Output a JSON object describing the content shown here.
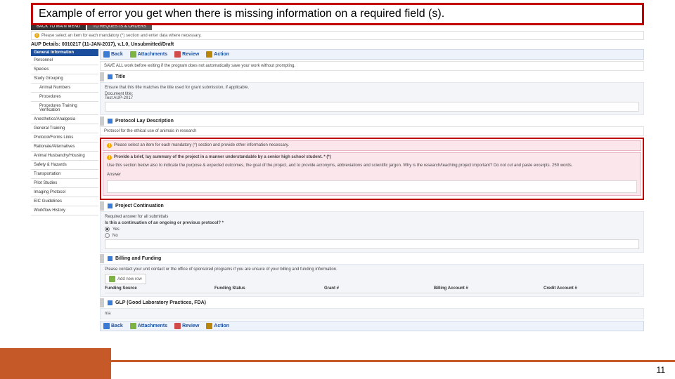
{
  "callout": "Example of error you get when there is missing information on a required field (s).",
  "tabs": {
    "back_main": "BACK TO MAIN MENU",
    "requests": "TO REQUESTS & ORDERS"
  },
  "top_warning": "Please select an item for each mandatory (*) section and enter data where necessary.",
  "protocol_line": "AUP Details: 0010217 (11-JAN-2017), v.1.0, Unsubmitted/Draft",
  "side_header": "General Information",
  "nav": {
    "personnel": "Personnel",
    "species": "Species",
    "study_grouping": "Study Grouping",
    "animal_numbers": "Animal Numbers",
    "procedures": "Procedures",
    "procedures_training": "Procedures Training Verification",
    "anesthetics": "Anesthetics/Analgesia",
    "general_training": "General Training",
    "protocol_forms": "Protocol/Forms Links",
    "rationale": "Rationale/Alternatives",
    "husbandry": "Animal Husbandry/Housing",
    "safety": "Safety & Hazards",
    "transportation": "Transportation",
    "pilot": "Pilot Studies",
    "imaging": "Imaging Protocol",
    "eic": "EIC Guidelines",
    "workflow": "Workflow History"
  },
  "toolbar": {
    "back": "Back",
    "attachments": "Attachments",
    "review": "Review",
    "action": "Action"
  },
  "save_note": "SAVE ALL work before exiting if the program does not automatically save your work without prompting.",
  "title_sec": {
    "heading": "Title",
    "hint": "Ensure that this title matches the title used for grant submission, if applicable.",
    "doc_label": "Document title:",
    "doc_value": "Test AUP-2017"
  },
  "lay_sec": {
    "heading": "Protocol Lay Description",
    "sub": "Protocol for the ethical use of animals in research",
    "errbar": "Please select an item for each mandatory (*) section and provide other information necessary.",
    "err_q": "Provide a brief, lay summary of the project in a manner understandable by a senior high school student. * (*)",
    "err_hint": "Use this section below also to indicate the purpose & expected outcomes, the goal of the project, and to provide acronyms, abbreviations and scientific jargon. Why is the research/teaching project important? Do not cut and paste excerpts. 250 words.",
    "answer_label": "Answer"
  },
  "cont_sec": {
    "heading": "Project Continuation",
    "req": "Required answer for all submittals",
    "q": "Is this a continuation of an ongoing or previous protocol? *",
    "yes": "Yes",
    "no": "No"
  },
  "bill_sec": {
    "heading": "Billing and Funding",
    "hint": "Please contact your unit contact or the office of sponsored programs if you are unsure of your billing and funding information.",
    "add": "Add new row",
    "c1": "Funding Source",
    "c2": "Funding Status",
    "c3": "Grant #",
    "c4": "Billing Account #",
    "c5": "Credit Account #"
  },
  "glp_sec": {
    "heading": "GLP (Good Laboratory Practices, FDA)",
    "na": "n/a"
  },
  "page_number": "11"
}
